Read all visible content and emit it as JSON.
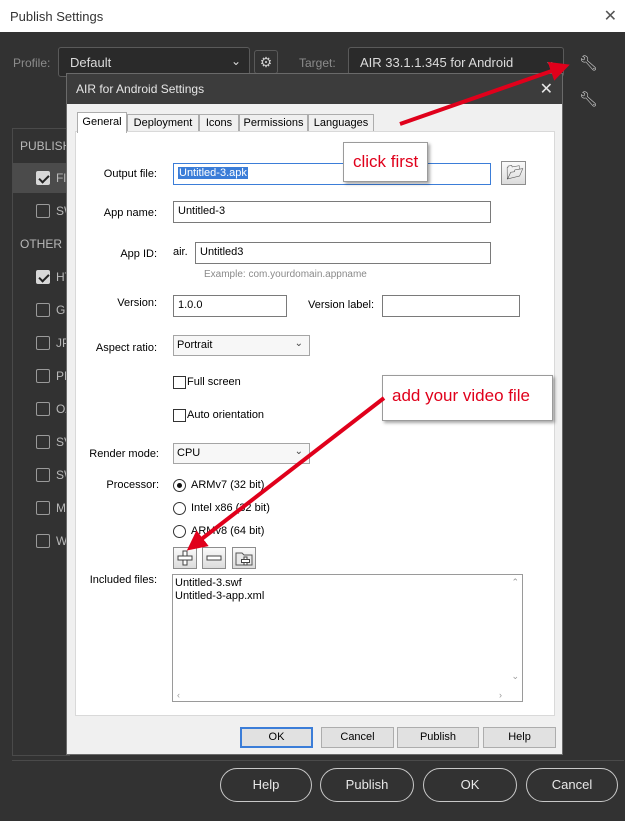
{
  "outer_window": {
    "title": "Publish Settings",
    "close_glyph": "✕",
    "profile_label": "Profile:",
    "profile_value": "Default",
    "target_label": "Target:",
    "target_value": "AIR 33.1.1.345 for Android",
    "sidebar": {
      "publish_heading": "PUBLISH",
      "other_heading": "OTHER FORMATS",
      "items": [
        {
          "label": "Flash",
          "checked": true,
          "selected": true
        },
        {
          "label": "SWC",
          "checked": false
        },
        {
          "label": "HTML",
          "checked": true
        },
        {
          "label": "GIF",
          "checked": false
        },
        {
          "label": "JPEG",
          "checked": false
        },
        {
          "label": "PNG",
          "checked": false
        },
        {
          "label": "OAM",
          "checked": false
        },
        {
          "label": "SVG",
          "checked": false
        },
        {
          "label": "SWF",
          "checked": false
        },
        {
          "label": "Mac",
          "checked": false
        },
        {
          "label": "Win",
          "checked": false
        }
      ]
    },
    "buttons": {
      "help": "Help",
      "publish": "Publish",
      "ok": "OK",
      "cancel": "Cancel"
    }
  },
  "dialog": {
    "title": "AIR for Android Settings",
    "close_glyph": "✕",
    "tabs": [
      "General",
      "Deployment",
      "Icons",
      "Permissions",
      "Languages"
    ],
    "active_tab": "General",
    "fields": {
      "output_file_label": "Output file:",
      "output_file_value": "Untitled-3.apk",
      "app_name_label": "App name:",
      "app_name_value": "Untitled-3",
      "app_id_label": "App ID:",
      "app_id_prefix": "air.",
      "app_id_value": "Untitled3",
      "app_id_hint": "Example: com.yourdomain.appname",
      "version_label": "Version:",
      "version_value": "1.0.0",
      "version_label_label": "Version label:",
      "version_label_value": "",
      "aspect_ratio_label": "Aspect ratio:",
      "aspect_ratio_value": "Portrait",
      "full_screen_label": "Full screen",
      "auto_orientation_label": "Auto orientation",
      "render_mode_label": "Render mode:",
      "render_mode_value": "CPU",
      "processor_label": "Processor:",
      "processor_options": [
        "ARMv7 (32 bit)",
        "Intel x86 (32 bit)",
        "ARMv8 (64 bit)"
      ],
      "processor_selected": "ARMv7 (32 bit)",
      "included_files_label": "Included files:",
      "included_files": [
        "Untitled-3.swf",
        "Untitled-3-app.xml"
      ]
    },
    "buttons": {
      "ok": "OK",
      "cancel": "Cancel",
      "publish": "Publish",
      "help": "Help"
    }
  },
  "annotations": {
    "callout_1": "click first",
    "callout_2": "add your video file",
    "color": "#e0001b"
  },
  "colors": {
    "dark_bg": "#323232",
    "dialog_bg": "#f0f0f0",
    "selection_blue": "#3b7dd8",
    "annotation_red": "#e0001b"
  }
}
